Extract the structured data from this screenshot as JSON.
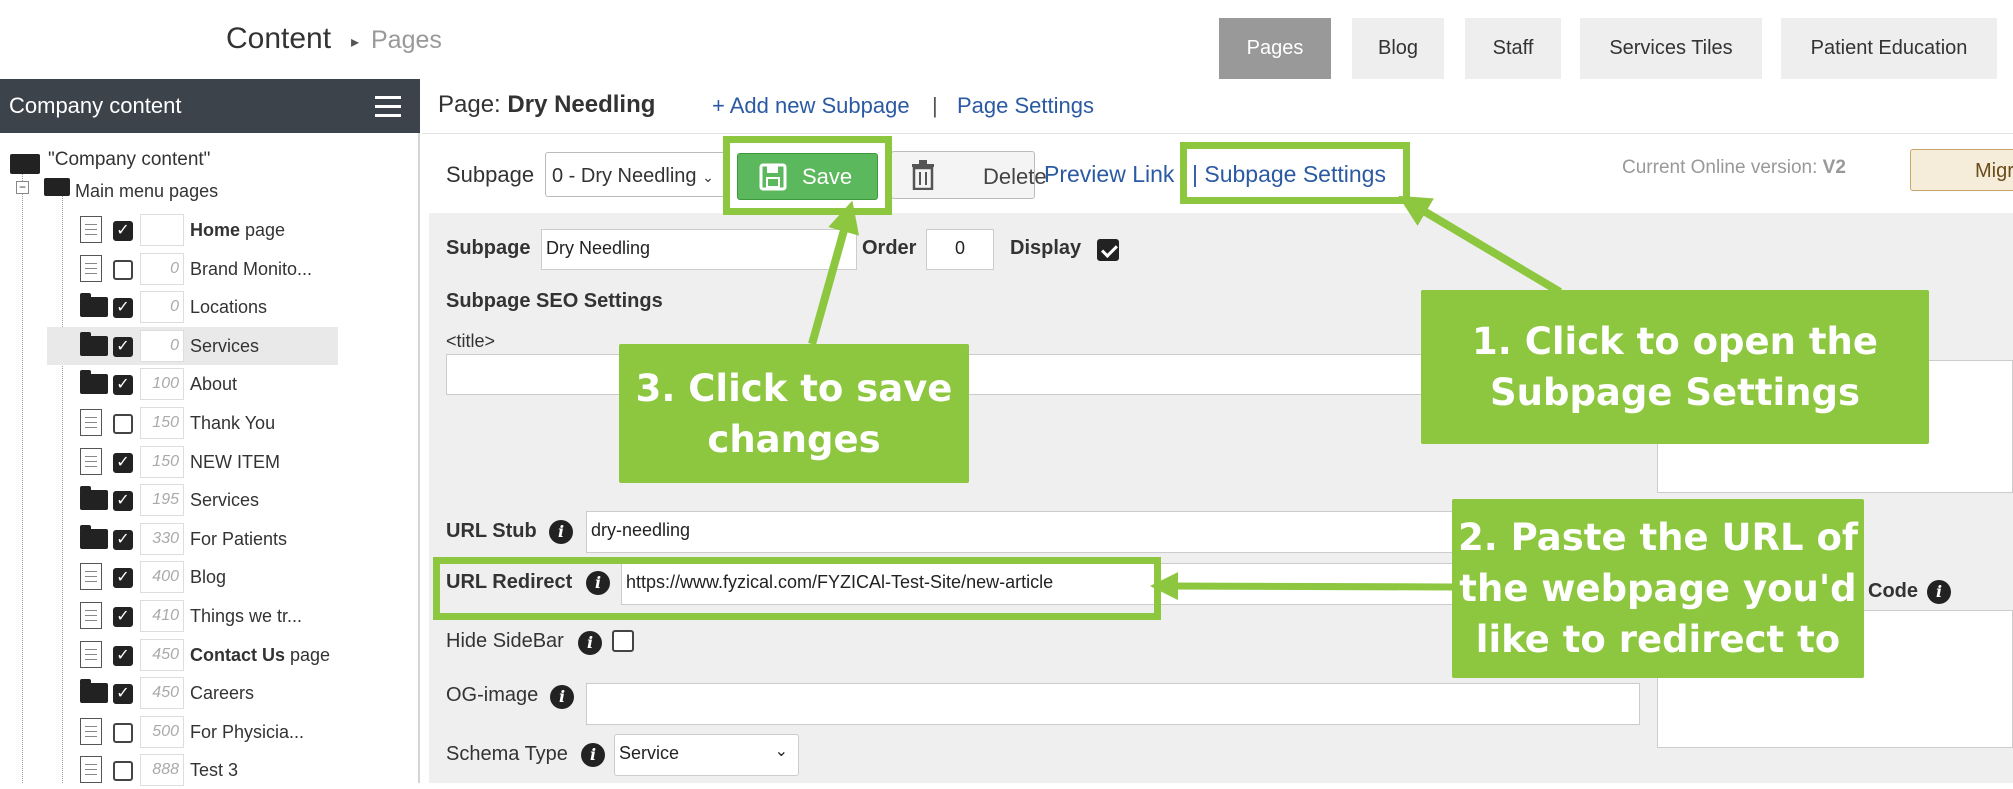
{
  "header": {
    "title": "Content",
    "breadcrumb": "Pages",
    "tabs": [
      {
        "label": "Pages",
        "active": true
      },
      {
        "label": "Blog",
        "active": false
      },
      {
        "label": "Staff",
        "active": false
      },
      {
        "label": "Services Tiles",
        "active": false
      },
      {
        "label": "Patient Education",
        "active": false
      }
    ]
  },
  "sidebar": {
    "title": "Company content",
    "root": "\"Company content\"",
    "main_menu": "Main menu pages",
    "items": [
      {
        "icon": "doc",
        "checked": true,
        "order": "",
        "label_bold": "Home",
        "label": " page",
        "highlight": false
      },
      {
        "icon": "doc",
        "checked": false,
        "order": "0",
        "label_bold": "",
        "label": "Brand Monito...",
        "highlight": false
      },
      {
        "icon": "folder",
        "checked": true,
        "order": "0",
        "label_bold": "",
        "label": "Locations",
        "highlight": false
      },
      {
        "icon": "folder",
        "checked": true,
        "order": "0",
        "label_bold": "",
        "label": "Services",
        "highlight": true
      },
      {
        "icon": "folder",
        "checked": true,
        "order": "100",
        "label_bold": "",
        "label": "About",
        "highlight": false
      },
      {
        "icon": "doc",
        "checked": false,
        "order": "150",
        "label_bold": "",
        "label": "Thank You",
        "highlight": false
      },
      {
        "icon": "doc",
        "checked": true,
        "order": "150",
        "label_bold": "",
        "label": "NEW ITEM",
        "highlight": false
      },
      {
        "icon": "folder",
        "checked": true,
        "order": "195",
        "label_bold": "",
        "label": "Services",
        "highlight": false
      },
      {
        "icon": "folder",
        "checked": true,
        "order": "330",
        "label_bold": "",
        "label": "For Patients",
        "highlight": false
      },
      {
        "icon": "doc",
        "checked": true,
        "order": "400",
        "label_bold": "",
        "label": "Blog",
        "highlight": false
      },
      {
        "icon": "doc",
        "checked": true,
        "order": "410",
        "label_bold": "",
        "label": "Things we tr...",
        "highlight": false
      },
      {
        "icon": "doc",
        "checked": true,
        "order": "450",
        "label_bold": "Contact Us",
        "label": " page",
        "highlight": false
      },
      {
        "icon": "folder",
        "checked": true,
        "order": "450",
        "label_bold": "",
        "label": "Careers",
        "highlight": false
      },
      {
        "icon": "doc",
        "checked": false,
        "order": "500",
        "label_bold": "",
        "label": "For Physicia...",
        "highlight": false
      },
      {
        "icon": "doc",
        "checked": false,
        "order": "888",
        "label_bold": "",
        "label": "Test 3",
        "highlight": false
      }
    ]
  },
  "page": {
    "prefix": "Page: ",
    "name": "Dry Needling",
    "add_subpage": "+ Add new Subpage",
    "separator": "|",
    "page_settings": "Page Settings"
  },
  "toolbar": {
    "subpage_label": "Subpage",
    "subpage_value": "0 - Dry Needling",
    "save_label": "Save",
    "delete_label": "Delete",
    "preview_label": "Preview Link",
    "subpage_settings_label": "| Subpage Settings",
    "current_version_label": "Current Online version:",
    "current_version": "V2",
    "migrate_label": "Migrate"
  },
  "form": {
    "subpage_label": "Subpage",
    "subpage_value": "Dry Needling",
    "order_label": "Order",
    "order_value": "0",
    "display_label": "Display",
    "display_checked": true,
    "seo_heading": "Subpage SEO Settings",
    "title_tag": "<title>",
    "title_value": "",
    "url_stub_label": "URL Stub",
    "url_stub_value": "dry-needling",
    "url_redirect_label": "URL Redirect",
    "url_redirect_value": "https://www.fyzical.com/FYZICAl-Test-Site/new-article",
    "hide_sidebar_label": "Hide SideBar",
    "hide_sidebar_checked": false,
    "og_image_label": "OG-image",
    "og_image_value": "",
    "schema_label": "Schema Type",
    "schema_value": "Service",
    "code_label": "Code"
  },
  "annotations": {
    "step1": [
      "1. Click to open the",
      "Subpage Settings"
    ],
    "step2": [
      "2. Paste the URL of",
      "the webpage you'd",
      "like to redirect to"
    ],
    "step3": [
      "3. Click to save",
      "changes"
    ],
    "accent_color": "#8dc63f"
  }
}
